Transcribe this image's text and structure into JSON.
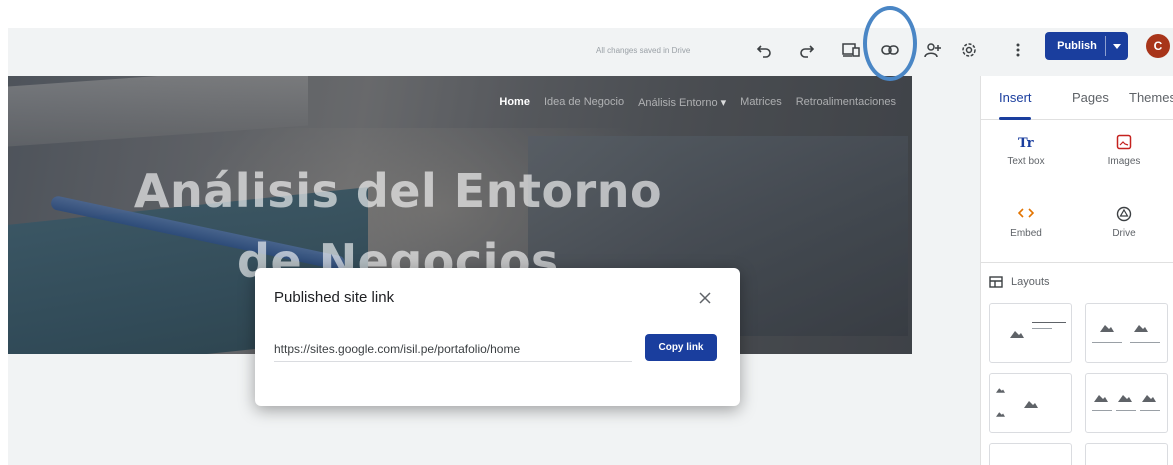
{
  "toolbar": {
    "saved_status": "All changes saved in Drive",
    "publish_label": "Publish",
    "avatar_initial": "C",
    "icons": [
      "undo-icon",
      "redo-icon",
      "preview-icon",
      "link-icon",
      "share-icon",
      "settings-icon",
      "more-icon"
    ]
  },
  "site": {
    "nav": [
      "Home",
      "Idea de Negocio",
      "Análisis Entorno",
      "Matrices",
      "Retroalimentaciones"
    ],
    "hero_title": "Análisis del Entorno de Negocios"
  },
  "dialog": {
    "title": "Published site link",
    "url": "https://sites.google.com/isil.pe/portafolio/home",
    "copy_label": "Copy link"
  },
  "panel": {
    "tabs": [
      "Insert",
      "Pages",
      "Themes"
    ],
    "items": [
      {
        "label": "Text box",
        "icon": "text-box-icon"
      },
      {
        "label": "Images",
        "icon": "images-icon"
      },
      {
        "label": "Embed",
        "icon": "embed-icon"
      },
      {
        "label": "Drive",
        "icon": "drive-icon"
      }
    ],
    "layouts_label": "Layouts"
  },
  "colors": {
    "accent": "#1a3e9e",
    "highlight_ring": "#4a86c5",
    "avatar": "#a8351a"
  }
}
